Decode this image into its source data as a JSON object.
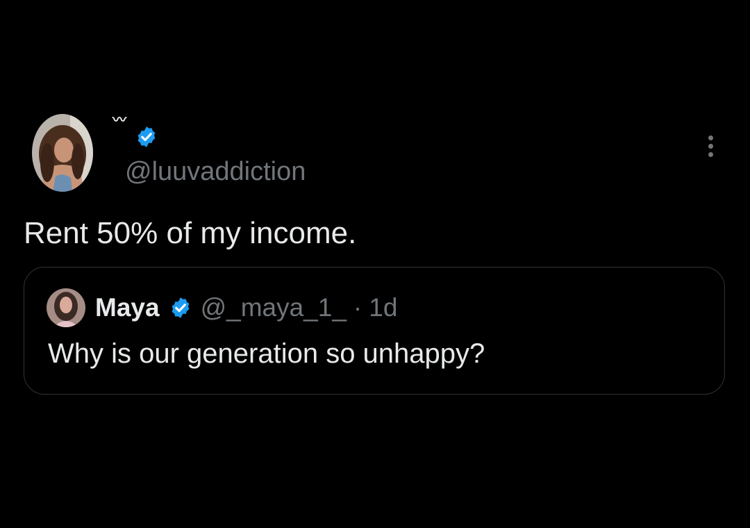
{
  "main_tweet": {
    "author": {
      "display_name": "〰",
      "handle": "@luuvaddiction",
      "verified": true
    },
    "text": "Rent 50% of my income."
  },
  "quoted_tweet": {
    "author": {
      "display_name": "Maya",
      "handle": "@_maya_1_",
      "verified": true
    },
    "separator": "·",
    "timestamp": "1d",
    "text": "Why is our generation so unhappy?"
  },
  "icons": {
    "verified": "verified-badge-icon",
    "more": "more-options-icon"
  },
  "colors": {
    "background": "#000000",
    "primary_text": "#e7e9ea",
    "secondary_text": "#71767b",
    "verified_blue": "#1d9bf0",
    "border": "#2f3336"
  }
}
